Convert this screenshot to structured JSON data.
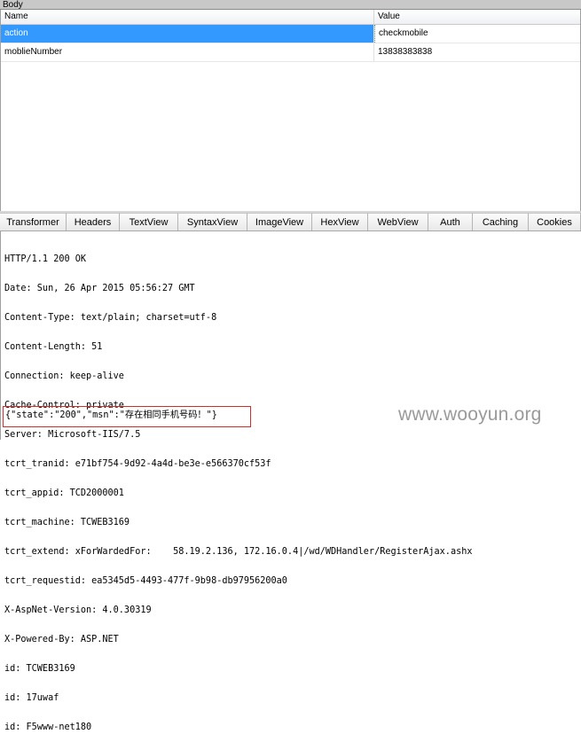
{
  "body_panel": {
    "title": "Body",
    "columns": {
      "name": "Name",
      "value": "Value"
    },
    "rows": [
      {
        "name": "action",
        "value": "checkmobile",
        "selected": true
      },
      {
        "name": "moblieNumber",
        "value": "13838383838",
        "selected": false
      }
    ]
  },
  "tabs": [
    {
      "label": "Transformer"
    },
    {
      "label": "Headers"
    },
    {
      "label": "TextView"
    },
    {
      "label": "SyntaxView"
    },
    {
      "label": "ImageView"
    },
    {
      "label": "HexView"
    },
    {
      "label": "WebView"
    },
    {
      "label": "Auth"
    },
    {
      "label": "Caching"
    },
    {
      "label": "Cookies"
    }
  ],
  "response": {
    "lines": [
      "HTTP/1.1 200 OK",
      "Date: Sun, 26 Apr 2015 05:56:27 GMT",
      "Content-Type: text/plain; charset=utf-8",
      "Content-Length: 51",
      "Connection: keep-alive",
      "Cache-Control: private",
      "Server: Microsoft-IIS/7.5",
      "tcrt_tranid: e71bf754-9d92-4a4d-be3e-e566370cf53f",
      "tcrt_appid: TCD2000001",
      "tcrt_machine: TCWEB3169",
      "tcrt_extend: xForWardedFor:    58.19.2.136, 172.16.0.4|/wd/WDHandler/RegisterAjax.ashx",
      "tcrt_requestid: ea5345d5-4493-477f-9b98-db97956200a0",
      "X-AspNet-Version: 4.0.30319",
      "X-Powered-By: ASP.NET",
      "id: TCWEB3169",
      "id: 17uwaf",
      "id: F5www-net180"
    ],
    "json_body": "{\"state\":\"200\",\"msn\":\"存在相同手机号码！\"}"
  },
  "watermark": "www.wooyun.org",
  "colors": {
    "selection": "#3399ff",
    "highlight_box": "#d42b2b"
  }
}
